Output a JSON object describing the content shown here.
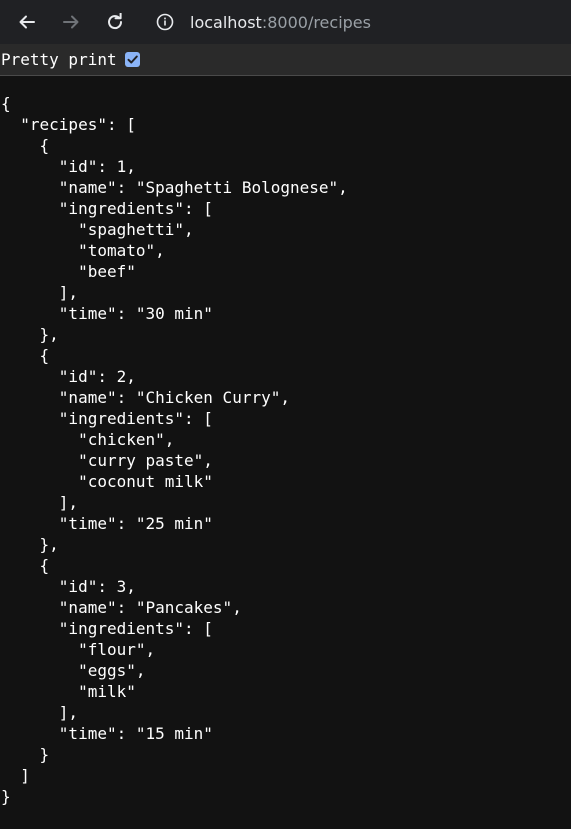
{
  "browser": {
    "url_host": "localhost",
    "url_rest": ":8000/recipes"
  },
  "viewer": {
    "pretty_print_label": "Pretty print",
    "pretty_print_checked": true
  },
  "json_lines": [
    "{",
    "  \"recipes\": [",
    "    {",
    "      \"id\": 1,",
    "      \"name\": \"Spaghetti Bolognese\",",
    "      \"ingredients\": [",
    "        \"spaghetti\",",
    "        \"tomato\",",
    "        \"beef\"",
    "      ],",
    "      \"time\": \"30 min\"",
    "    },",
    "    {",
    "      \"id\": 2,",
    "      \"name\": \"Chicken Curry\",",
    "      \"ingredients\": [",
    "        \"chicken\",",
    "        \"curry paste\",",
    "        \"coconut milk\"",
    "      ],",
    "      \"time\": \"25 min\"",
    "    },",
    "    {",
    "      \"id\": 3,",
    "      \"name\": \"Pancakes\",",
    "      \"ingredients\": [",
    "        \"flour\",",
    "        \"eggs\",",
    "        \"milk\"",
    "      ],",
    "      \"time\": \"15 min\"",
    "    }",
    "  ]",
    "}"
  ],
  "icons": {
    "back": "arrow-left-icon",
    "forward": "arrow-right-icon",
    "reload": "reload-icon",
    "site_info": "info-icon",
    "checkbox": "checkmark-icon"
  },
  "colors": {
    "toolbar_bg": "#202124",
    "content_bg": "#121212",
    "checkbox_accent": "#8ab4f8"
  }
}
